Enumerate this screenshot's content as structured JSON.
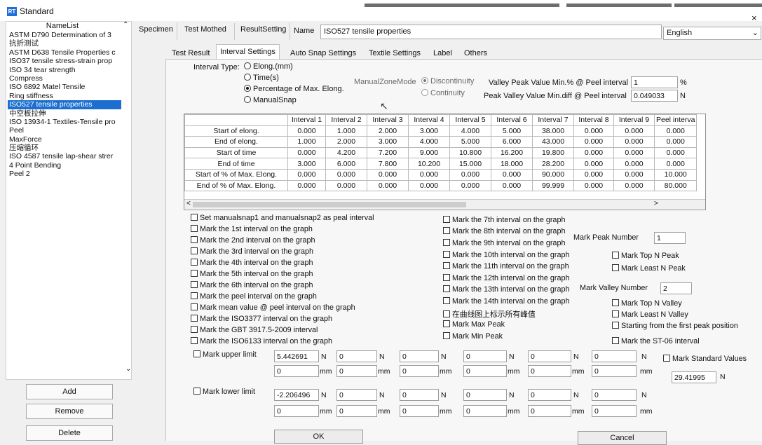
{
  "window": {
    "title": "Standard",
    "icon_text": "RT",
    "close": "×"
  },
  "left_panel": {
    "header": "NameList",
    "selected_index": 8,
    "items": [
      "ASTM D790 Determination of 3",
      "抗折测试",
      "ASTM D638 Tensile Properties c",
      "ISO37 tensile stress-strain prop",
      "ISO 34 tear strength",
      "Compress",
      "ISO 6892 Matel Tensile",
      "Ring stiffness",
      "ISO527 tensile properties",
      "中空板拉伸",
      "ISO 13934-1 Textiles-Tensile pro",
      "Peel",
      "MaxForce",
      "压缩循环",
      "ISO 4587 tensile lap-shear strer",
      "4 Point Bending",
      "Peel 2"
    ],
    "buttons": {
      "add": "Add",
      "remove": "Remove",
      "delete": "Delete"
    }
  },
  "top_tabs": {
    "specimen": "Specimen",
    "test_method": "Test Mothed",
    "result_setting": "ResultSetting"
  },
  "name": {
    "label": "Name",
    "value": "ISO527 tensile properties"
  },
  "language": {
    "value": "English"
  },
  "sub_tabs": {
    "test_result": "Test Result",
    "interval_settings": "Interval Settings",
    "auto_snap": "Auto Snap Settings",
    "textile": "Textile Settings",
    "label": "Label",
    "others": "Others"
  },
  "interval_type": {
    "label": "Interval Type:",
    "options": [
      "Elong.(mm)",
      "Time(s)",
      "Percentage of Max. Elong.",
      "ManualSnap"
    ],
    "selected": "Percentage of Max. Elong."
  },
  "manual_zone": {
    "label": "ManualZoneMode",
    "options": [
      "Discontinuity",
      "Continuity"
    ],
    "selected": "Discontinuity"
  },
  "valley_peak": {
    "label": "Valley Peak Value Min.% @ Peel interval",
    "value": "1",
    "unit": "%"
  },
  "peak_valley": {
    "label": "Peak Valley Value Min.diff @ Peel interval",
    "value": "0.049033",
    "unit": "N"
  },
  "interval_table": {
    "headers": [
      "Interval 1",
      "Interval 2",
      "Interval 3",
      "Interval 4",
      "Interval 5",
      "Interval 6",
      "Interval 7",
      "Interval 8",
      "Interval 9",
      "Peel interva"
    ],
    "rows": [
      {
        "label": "Start of elong.",
        "values": [
          "0.000",
          "1.000",
          "2.000",
          "3.000",
          "4.000",
          "5.000",
          "38.000",
          "0.000",
          "0.000",
          "0.000"
        ]
      },
      {
        "label": "End of elong.",
        "values": [
          "1.000",
          "2.000",
          "3.000",
          "4.000",
          "5.000",
          "6.000",
          "43.000",
          "0.000",
          "0.000",
          "0.000"
        ]
      },
      {
        "label": "Start of time",
        "values": [
          "0.000",
          "4.200",
          "7.200",
          "9.000",
          "10.800",
          "16.200",
          "19.800",
          "0.000",
          "0.000",
          "0.000"
        ]
      },
      {
        "label": "End of time",
        "values": [
          "3.000",
          "6.000",
          "7.800",
          "10.200",
          "15.000",
          "18.000",
          "28.200",
          "0.000",
          "0.000",
          "0.000"
        ]
      },
      {
        "label": "Start of % of Max. Elong.",
        "values": [
          "0.000",
          "0.000",
          "0.000",
          "0.000",
          "0.000",
          "0.000",
          "90.000",
          "0.000",
          "0.000",
          "10.000"
        ]
      },
      {
        "label": "End of % of Max. Elong.",
        "values": [
          "0.000",
          "0.000",
          "0.000",
          "0.000",
          "0.000",
          "0.000",
          "99.999",
          "0.000",
          "0.000",
          "80.000"
        ]
      }
    ],
    "scroll_left": "<",
    "scroll_right": ">"
  },
  "checks_left": [
    "Set manualsnap1 and manualsnap2 as peal interval",
    "Mark the 1st interval on the graph",
    "Mark the 2nd interval on the graph",
    "Mark the 3rd interval on the graph",
    "Mark the 4th interval on the graph",
    "Mark the 5th interval on the graph",
    "Mark the 6th interval on the graph",
    "Mark the peel interval on the graph",
    "Mark mean value @ peel interval on the graph",
    "Mark the ISO3377 interval on the graph",
    "Mark the GBT 3917.5-2009 interval",
    "Mark the ISO6133 interval on the graph"
  ],
  "checks_mid": [
    "Mark the 7th interval on the graph",
    "Mark the 8th interval on the graph",
    "Mark the 9th interval on the graph",
    "Mark the 10th interval on the graph",
    "Mark the 11th interval on the graph",
    "Mark the 12th interval on the graph",
    "Mark the 13th interval on the graph",
    "Mark the 14th interval on the graph",
    "在曲线图上标示所有峰值",
    "Mark Max Peak",
    "Mark Min Peak"
  ],
  "peak": {
    "number_label": "Mark Peak Number",
    "number_value": "1",
    "top_n": "Mark Top N Peak",
    "least_n": "Mark Least N Peak"
  },
  "valley": {
    "number_label": "Mark Valley Number",
    "number_value": "2",
    "top_n": "Mark Top N Valley",
    "least_n": "Mark Least N Valley",
    "first_peak": "Starting from the first peak position",
    "st06": "Mark the ST-06 interval"
  },
  "upper_limit": {
    "label": "Mark upper limit",
    "n_values": [
      "5.442691",
      "0",
      "0",
      "0",
      "0",
      "0"
    ],
    "mm_values": [
      "0",
      "0",
      "0",
      "0",
      "0",
      "0"
    ],
    "unit_n": "N",
    "unit_mm": "mm"
  },
  "lower_limit": {
    "label": "Mark lower limit",
    "n_values": [
      "-2.206496",
      "0",
      "0",
      "0",
      "0",
      "0"
    ],
    "mm_values": [
      "0",
      "0",
      "0",
      "0",
      "0",
      "0"
    ]
  },
  "standard_values": {
    "label": "Mark Standard Values",
    "value": "29.41995",
    "unit": "N"
  },
  "footer": {
    "ok": "OK",
    "cancel": "Cancel"
  }
}
